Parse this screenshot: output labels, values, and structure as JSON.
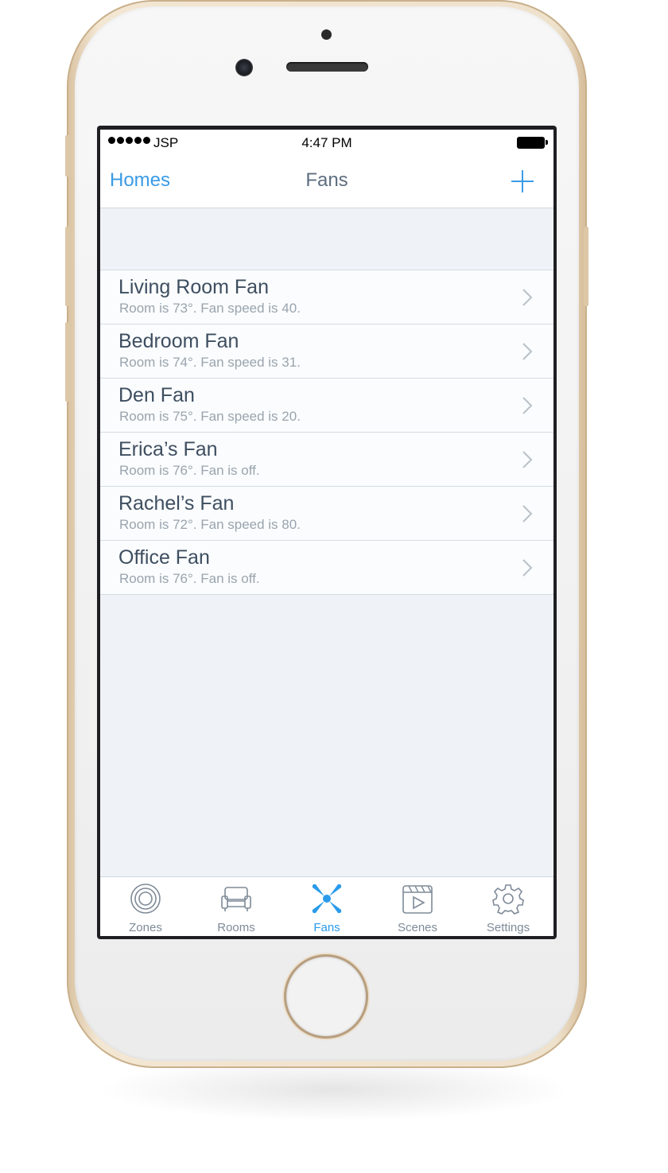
{
  "status_bar": {
    "carrier": "JSP",
    "time": "4:47 PM"
  },
  "nav": {
    "back_label": "Homes",
    "title": "Fans",
    "add_icon": "plus-icon"
  },
  "fans": [
    {
      "name": "Living Room Fan",
      "status": "Room is 73°. Fan speed is 40."
    },
    {
      "name": "Bedroom Fan",
      "status": "Room is 74°. Fan speed is 31."
    },
    {
      "name": "Den Fan",
      "status": "Room is 75°. Fan speed is 20."
    },
    {
      "name": "Erica’s Fan",
      "status": "Room is 76°. Fan is off."
    },
    {
      "name": "Rachel’s Fan",
      "status": "Room is 72°. Fan speed is 80."
    },
    {
      "name": "Office Fan",
      "status": "Room is 76°. Fan is off."
    }
  ],
  "tabs": [
    {
      "label": "Zones",
      "icon": "zones-icon"
    },
    {
      "label": "Rooms",
      "icon": "sofa-icon"
    },
    {
      "label": "Fans",
      "icon": "fan-icon",
      "active": true
    },
    {
      "label": "Scenes",
      "icon": "clapperboard-icon"
    },
    {
      "label": "Settings",
      "icon": "gear-icon"
    }
  ],
  "colors": {
    "accent": "#2a9bea",
    "text": "#3e4e60",
    "subtext": "#9aa4ae",
    "background": "#eff3f7"
  }
}
